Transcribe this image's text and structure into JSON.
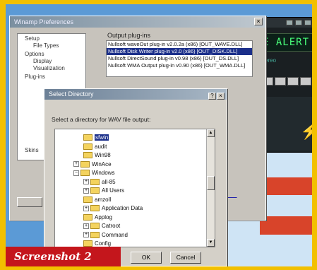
{
  "prefs_window": {
    "title": "Winamp Preferences",
    "close_glyph": "×",
    "tree": [
      "Setup",
      "File Types",
      "Options",
      "Display",
      "Visualization",
      "Plug-ins",
      "Skins"
    ],
    "output_plugins_label": "Output plug-ins",
    "output_plugins": [
      "Nullsoft waveOut plug-in v2.0.2a (x86)   [OUT_WAVE.DLL]",
      "Nullsoft Disk Writer plug-in v2.0 (x86)   [OUT_DISK.DLL]",
      "Nullsoft DirectSound plug-in v0.98 (x86)   [OUT_DS.DLL]",
      "Nullsoft WMA Output plug-in v0.90 (x86)   [OUT_WMA.DLL]"
    ],
    "selected_plugin_index": 1
  },
  "winamp": {
    "display_text": "VE ALERT",
    "info_text": "kbps   khz   stereo",
    "icon": "lightning-bolt-icon"
  },
  "dialog": {
    "title": "Select Directory",
    "title_buttons": [
      "?",
      "×"
    ],
    "prompt": "Select a directory for WAV file output:",
    "folders": [
      {
        "label": "sfwin",
        "indent": 2,
        "selected": true,
        "expander": "",
        "highlight": true
      },
      {
        "label": "audit",
        "indent": 2,
        "selected": false,
        "expander": ""
      },
      {
        "label": "Win98",
        "indent": 2,
        "selected": false,
        "expander": ""
      },
      {
        "label": "WinAce",
        "indent": 1,
        "selected": false,
        "expander": "+"
      },
      {
        "label": "Windows",
        "indent": 1,
        "selected": false,
        "expander": "−"
      },
      {
        "label": "all-85",
        "indent": 2,
        "selected": false,
        "expander": "+"
      },
      {
        "label": "All Users",
        "indent": 2,
        "selected": false,
        "expander": "+"
      },
      {
        "label": "amzoll",
        "indent": 2,
        "selected": false,
        "expander": ""
      },
      {
        "label": "Application Data",
        "indent": 2,
        "selected": false,
        "expander": "+"
      },
      {
        "label": "Applog",
        "indent": 2,
        "selected": false,
        "expander": ""
      },
      {
        "label": "Catroot",
        "indent": 2,
        "selected": false,
        "expander": "+"
      },
      {
        "label": "Command",
        "indent": 2,
        "selected": false,
        "expander": "+"
      },
      {
        "label": "Config",
        "indent": 2,
        "selected": false,
        "expander": ""
      }
    ],
    "ok_label": "OK",
    "cancel_label": "Cancel"
  },
  "caption": "Screenshot 2",
  "colors": {
    "frame": "#f2c000",
    "desktop": "#5b9ad6",
    "selection": "#1b2f8a",
    "caption_bg": "#c4161c",
    "lcd_text": "#49ff7a"
  }
}
